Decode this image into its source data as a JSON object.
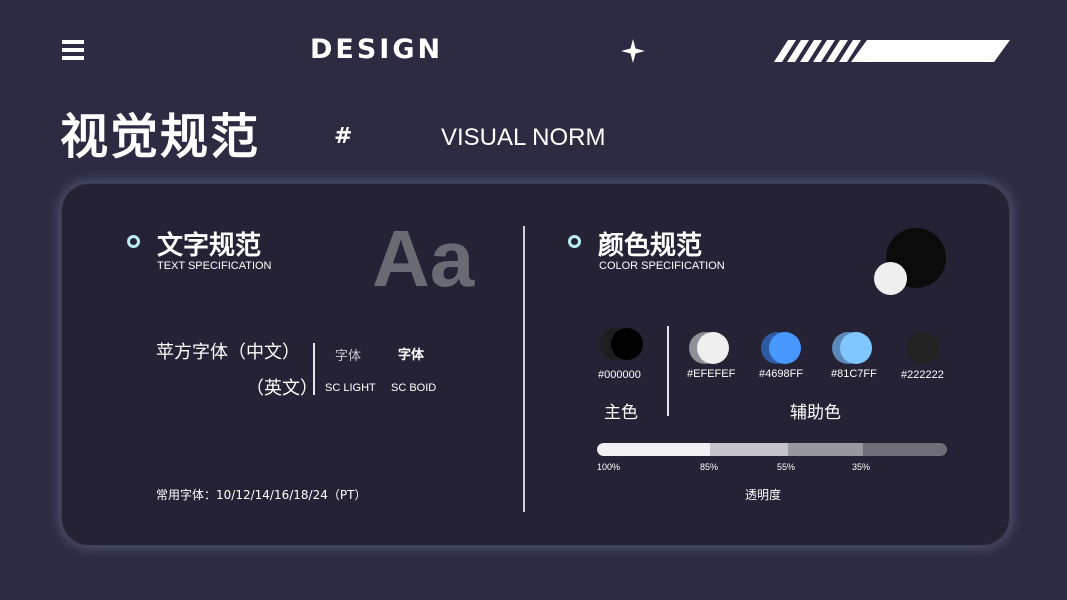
{
  "header": {
    "brand": "DESIGN",
    "menu_icon": "hamburger-menu-icon",
    "spark_icon": "four-point-star-icon"
  },
  "heading": {
    "title": "视觉规范",
    "hash": "#",
    "subtitle": "VISUAL NORM"
  },
  "text_spec": {
    "title": "文字规范",
    "subtitle": "TEXT SPECIFICATION",
    "sample": "Aa",
    "font_name_cn": "苹方字体（中文）",
    "font_name_en": "（英文）",
    "sample_light": "字体",
    "sample_bold": "字体",
    "label_light": "SC LIGHT",
    "label_bold": "SC BOID",
    "sizes": "常用字体：10/12/14/16/18/24（PT）"
  },
  "color_spec": {
    "title": "颜色规范",
    "subtitle": "COLOR SPECIFICATION",
    "main_label": "主色",
    "aux_label": "辅助色",
    "swatches": [
      {
        "hex": "#000000",
        "color": "#000000",
        "shadow": "#1e1e22"
      },
      {
        "hex": "#EFEFEF",
        "color": "#efefef",
        "shadow": "#8f8f96"
      },
      {
        "hex": "#4698FF",
        "color": "#4698ff",
        "shadow": "#2f5aa0"
      },
      {
        "hex": "#81C7FF",
        "color": "#81c7ff",
        "shadow": "#5b88b8"
      },
      {
        "hex": "#222222",
        "color": "#222222",
        "shadow": "#222222"
      }
    ],
    "opacity_levels": [
      "100%",
      "85%",
      "55%",
      "35%"
    ],
    "opacity_label": "透明度"
  }
}
